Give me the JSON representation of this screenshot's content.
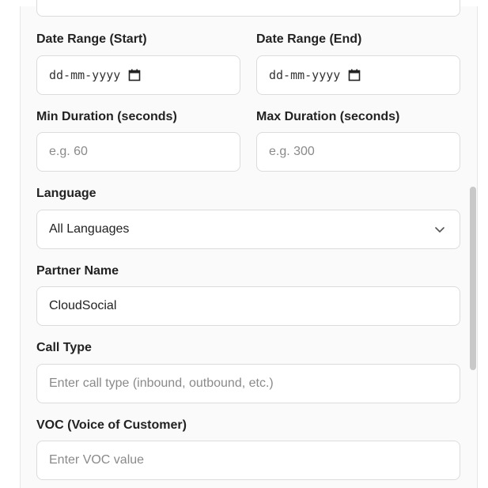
{
  "form": {
    "date_start": {
      "label": "Date Range (Start)",
      "placeholder": "dd-mm-yyyy",
      "icon": "calendar-icon"
    },
    "date_end": {
      "label": "Date Range (End)",
      "placeholder": "dd-mm-yyyy",
      "icon": "calendar-icon"
    },
    "min_duration": {
      "label": "Min Duration (seconds)",
      "placeholder": "e.g. 60"
    },
    "max_duration": {
      "label": "Max Duration (seconds)",
      "placeholder": "e.g. 300"
    },
    "language": {
      "label": "Language",
      "selected": "All Languages",
      "icon": "chevron-down-icon"
    },
    "partner_name": {
      "label": "Partner Name",
      "value": "CloudSocial"
    },
    "call_type": {
      "label": "Call Type",
      "placeholder": "Enter call type (inbound, outbound, etc.)"
    },
    "voc": {
      "label": "VOC (Voice of Customer)",
      "placeholder": "Enter VOC value"
    }
  },
  "colors": {
    "panel_bg": "#fafafa",
    "border": "#dcdcdc",
    "placeholder": "#8a8a8a",
    "scrollbar": "#c9c9c9"
  }
}
